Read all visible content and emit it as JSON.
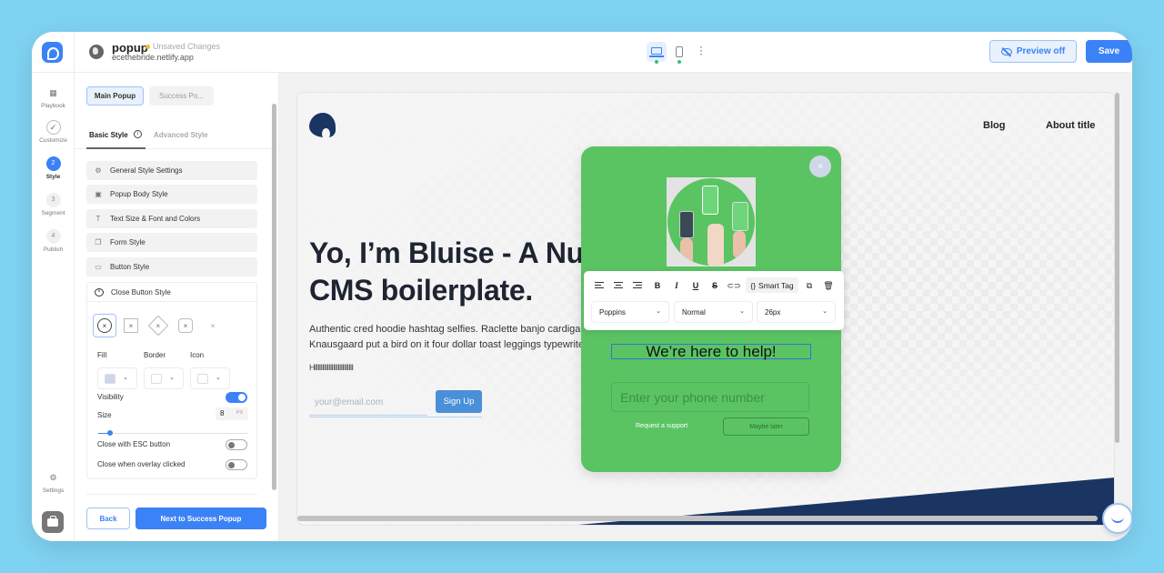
{
  "header": {
    "project_name": "popup",
    "unsaved_label": "Unsaved Changes",
    "site_url": "ecethebride.netlify.app",
    "devices": [
      {
        "name": "desktop",
        "active": true
      },
      {
        "name": "mobile",
        "active": false
      }
    ],
    "preview_label": "Preview off",
    "save_label": "Save"
  },
  "rail": {
    "items": [
      {
        "icon": "grid-icon",
        "badge": "",
        "label": "Playbook"
      },
      {
        "icon": "check-icon",
        "badge": "✓",
        "label": "Customize"
      },
      {
        "icon": "step-icon",
        "badge": "2",
        "label": "Style",
        "active": true
      },
      {
        "icon": "step-icon",
        "badge": "3",
        "label": "Segment"
      },
      {
        "icon": "step-icon",
        "badge": "4",
        "label": "Publish"
      }
    ],
    "settings_label": "Settings"
  },
  "panel": {
    "popup_tabs": [
      "Main Popup",
      "Success Po..."
    ],
    "style_tabs": [
      "Basic Style",
      "Advanced Style"
    ],
    "sections": [
      {
        "icon": "gear-icon",
        "label": "General Style Settings"
      },
      {
        "icon": "image-icon",
        "label": "Popup Body Style"
      },
      {
        "icon": "text-icon",
        "label": "Text Size & Font and Colors"
      },
      {
        "icon": "form-icon",
        "label": "Form Style"
      },
      {
        "icon": "button-icon",
        "label": "Button Style"
      }
    ],
    "close_button": {
      "title": "Close Button Style",
      "shapes": [
        "circle",
        "square",
        "diamond",
        "rounded",
        "none"
      ],
      "selected_shape": "circle",
      "fill_label": "Fill",
      "border_label": "Border",
      "icon_label": "Icon",
      "fill_color": "#cdd6ea",
      "border_color": "#ffffff",
      "icon_color": "#ffffff",
      "visibility_label": "Visibility",
      "visibility_on": true,
      "size_label": "Size",
      "size_value": "8",
      "size_unit": "PX",
      "size_slider_fraction": 0.08,
      "esc_label": "Close with ESC button",
      "esc_on": false,
      "overlay_label": "Close when overlay clicked",
      "overlay_on": false
    },
    "back_label": "Back",
    "next_label": "Next to Success Popup"
  },
  "site": {
    "nav": [
      "Blog",
      "About title"
    ],
    "hero_title_line1": "Yo, I’m Bluise - A Nuxt",
    "hero_title_line2": "CMS boilerplate.",
    "hero_text_line1": "Authentic cred hoodie hashtag selfies. Raclette banjo cardigan",
    "hero_text_line2": "Knausgaard put a bird on it four dollar toast leggings typewriter",
    "hero_h": "HIIIIIIIIIIIIIIIIIIIIIIIII",
    "email_placeholder": "your@email.com",
    "signup_label": "Sign Up"
  },
  "popup": {
    "bg_color": "#5ac463",
    "close_glyph": "×",
    "heading": "We’re here to help!",
    "phone_placeholder": "Enter your phone number",
    "request_label": "Request a support",
    "maybe_label": "Maybe later"
  },
  "toolbar": {
    "smart_tag_label": "Smart Tag",
    "bold_glyph": "B",
    "italic_glyph": "I",
    "underline_glyph": "U",
    "strike_glyph": "S",
    "font": "Poppins",
    "weight": "Normal",
    "size": "26px"
  }
}
